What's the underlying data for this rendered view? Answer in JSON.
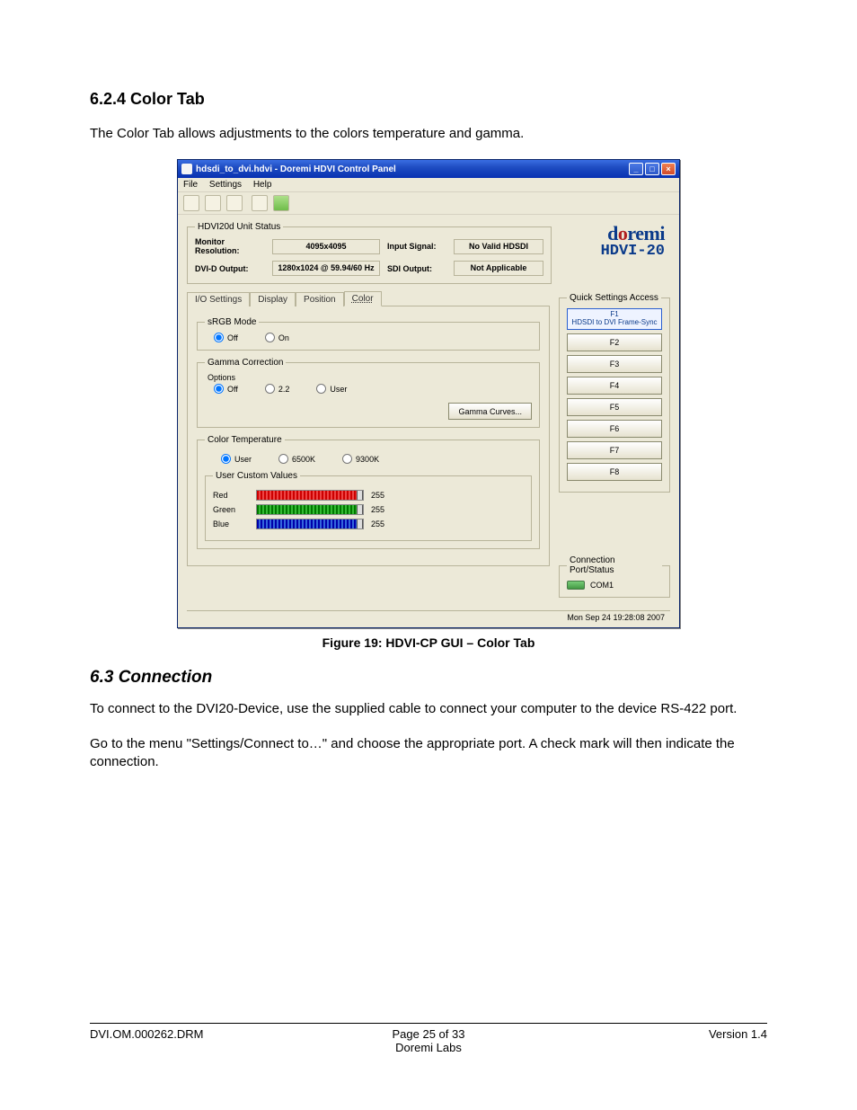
{
  "doc": {
    "section_heading": "6.2.4  Color Tab",
    "section_body": "The Color Tab allows adjustments to the colors temperature and gamma.",
    "figure_caption_prefix": "Figure ",
    "figure_number": "19",
    "figure_caption_suffix": ": HDVI-CP GUI – Color Tab",
    "subsection_heading": "6.3  Connection",
    "conn_p1": "To connect to the DVI20-Device, use the supplied cable to connect your computer to the device RS-422 port.",
    "conn_p2": "Go to the menu \"Settings/Connect to…\" and choose the appropriate port. A check mark will then indicate the connection."
  },
  "app": {
    "title": "hdsdi_to_dvi.hdvi - Doremi HDVI Control Panel",
    "menu": {
      "file": "File",
      "settings": "Settings",
      "help": "Help"
    },
    "logo_text": "doremi",
    "logo_sub": "HDVI-20",
    "status_group": "HDVI20d Unit Status",
    "status": {
      "mon_res_label": "Monitor Resolution:",
      "mon_res_value": "4095x4095",
      "input_label": "Input Signal:",
      "input_value": "No Valid HDSDI",
      "dvi_label": "DVI-D Output:",
      "dvi_value": "1280x1024 @ 59.94/60 Hz",
      "sdi_label": "SDI Output:",
      "sdi_value": "Not Applicable"
    },
    "tabs": {
      "io": "I/O Settings",
      "display": "Display",
      "position": "Position",
      "color": "Color"
    },
    "srgb": {
      "legend": "sRGB Mode",
      "off": "Off",
      "on": "On",
      "selected": "off"
    },
    "gamma": {
      "legend": "Gamma Correction",
      "options_legend": "Options",
      "off": "Off",
      "v22": "2.2",
      "user": "User",
      "selected": "off",
      "curves_btn": "Gamma Curves..."
    },
    "coltemp": {
      "legend": "Color Temperature",
      "user": "User",
      "k6500": "6500K",
      "k9300": "9300K",
      "selected": "user",
      "custom_legend": "User Custom Values",
      "red_label": "Red",
      "green_label": "Green",
      "blue_label": "Blue",
      "red_value": "255",
      "green_value": "255",
      "blue_value": "255"
    },
    "quick": {
      "legend": "Quick Settings Access",
      "f1_line1": "F1",
      "f1_line2": "HDSDI to DVI Frame-Sync",
      "f2": "F2",
      "f3": "F3",
      "f4": "F4",
      "f5": "F5",
      "f6": "F6",
      "f7": "F7",
      "f8": "F8"
    },
    "conn": {
      "legend": "Connection Port/Status",
      "port": "COM1"
    },
    "timestamp": "Mon Sep 24 19:28:08 2007"
  },
  "footer": {
    "left": "DVI.OM.000262.DRM",
    "center1": "Page 25 of 33",
    "center2": "Doremi Labs",
    "right": "Version 1.4"
  }
}
